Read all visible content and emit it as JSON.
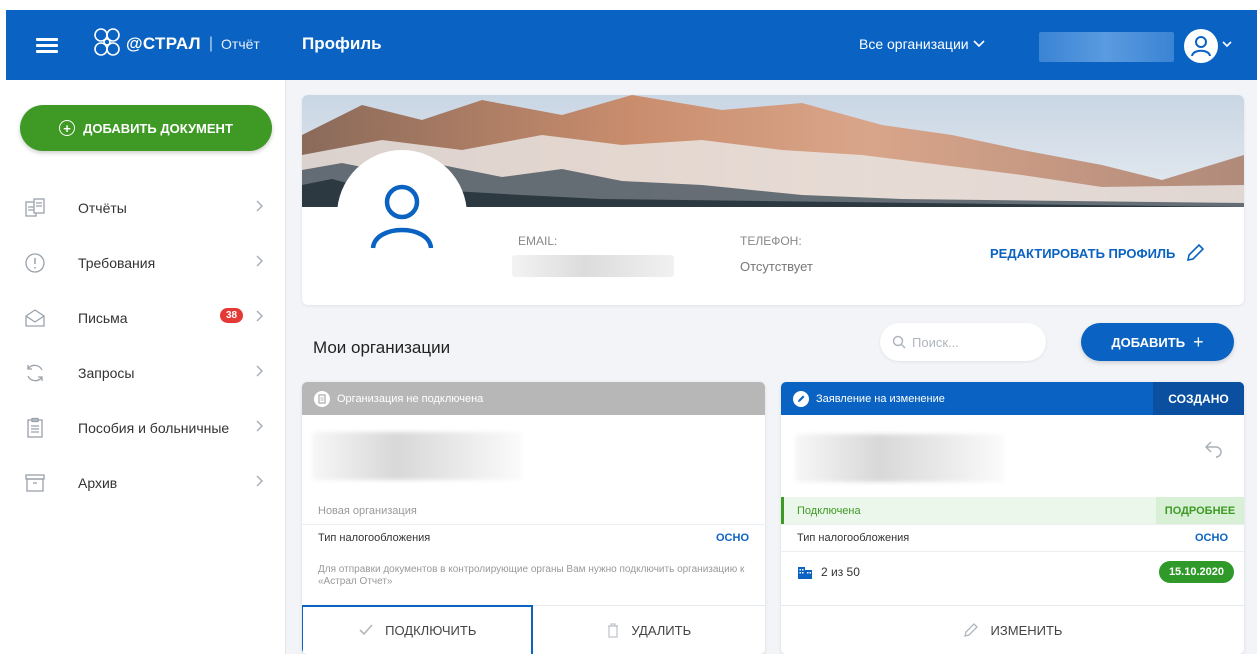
{
  "header": {
    "brand": "@СТРАЛ",
    "product": "Отчёт",
    "page_title": "Профиль",
    "org_selector": "Все организации"
  },
  "sidebar": {
    "add_document": "ДОБАВИТЬ ДОКУМЕНТ",
    "items": [
      {
        "label": "Отчёты",
        "icon": "reports-icon"
      },
      {
        "label": "Требования",
        "icon": "alert-circle-icon"
      },
      {
        "label": "Письма",
        "icon": "envelope-icon",
        "badge": "38"
      },
      {
        "label": "Запросы",
        "icon": "refresh-icon"
      },
      {
        "label": "Пособия и больничные",
        "icon": "clipboard-icon"
      },
      {
        "label": "Архив",
        "icon": "archive-icon"
      }
    ]
  },
  "profile": {
    "email_label": "EMAIL:",
    "phone_label": "ТЕЛЕФОН:",
    "phone_value": "Отсутствует",
    "edit_label": "РЕДАКТИРОВАТЬ ПРОФИЛЬ"
  },
  "orgs": {
    "title": "Мои организации",
    "search_placeholder": "Поиск...",
    "add_label": "ДОБАВИТЬ",
    "cards": [
      {
        "header": "Организация не подключена",
        "status_text": "Новая организация",
        "tax_label": "Тип налогообложения",
        "tax_value": "ОСНО",
        "note": "Для отправки документов в контролирующие органы Вам нужно подключить организацию к «Астрал Отчет»",
        "connect_label": "ПОДКЛЮЧИТЬ",
        "delete_label": "УДАЛИТЬ"
      },
      {
        "header": "Заявление на изменение",
        "badge": "СОЗДАНО",
        "status_text": "Подключена",
        "more_label": "ПОДРОБНЕЕ",
        "tax_label": "Тип налогообложения",
        "tax_value": "ОСНО",
        "usage": "2 из 50",
        "date": "15.10.2020",
        "edit_label": "ИЗМЕНИТЬ"
      }
    ]
  },
  "colors": {
    "primary": "#0a63c2",
    "success": "#3e9a24",
    "badge": "#e53935",
    "disabled_header": "#b7b7b7"
  }
}
